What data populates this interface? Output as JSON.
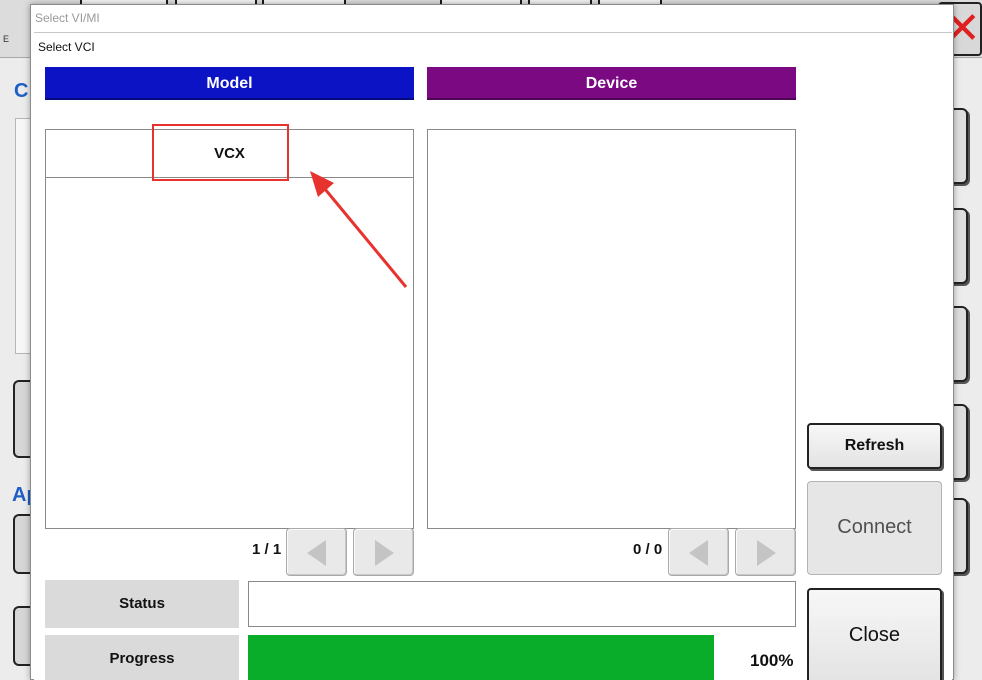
{
  "window": {
    "outer_title": "Select VI/MI",
    "inner_title": "Select VCI"
  },
  "background": {
    "toolbar_label": "E",
    "section_letter_1": "C",
    "section_letter_2": "Ap",
    "close_glyph": "✕"
  },
  "model_panel": {
    "header": "Model",
    "items": [
      "VCX"
    ],
    "page_indicator": "1 / 1"
  },
  "device_panel": {
    "header": "Device",
    "items": [],
    "page_indicator": "0 / 0"
  },
  "status": {
    "label": "Status",
    "value": ""
  },
  "progress": {
    "label": "Progress",
    "percent_text": "100%",
    "fraction": 0.85
  },
  "actions": {
    "refresh": "Refresh",
    "connect": "Connect",
    "close": "Close"
  },
  "colors": {
    "model_header": "#0b13c5",
    "device_header": "#7b0a82",
    "progress_fill": "#0aad2a",
    "annotation": "#e8322e"
  },
  "icons": {
    "prev": "chevron-left-icon",
    "next": "chevron-right-icon"
  }
}
